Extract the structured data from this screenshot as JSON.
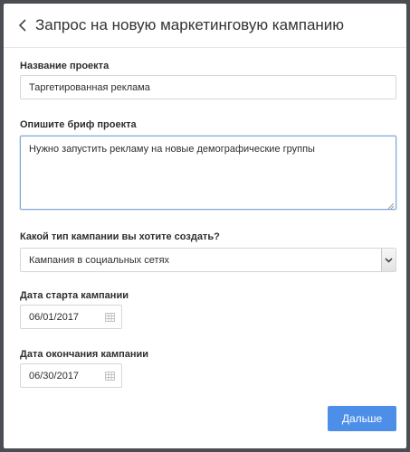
{
  "header": {
    "title": "Запрос на новую маркетинговую кампанию",
    "back_icon": "chevron-left-icon"
  },
  "form": {
    "project_name": {
      "label": "Название проекта",
      "value": "Таргетированная реклама"
    },
    "brief": {
      "label": "Опишите бриф проекта",
      "value": "Нужно запустить рекламу на новые демографические группы"
    },
    "campaign_type": {
      "label": "Какой тип кампании вы хотите создать?",
      "selected": "Кампания в социальных сетях"
    },
    "start_date": {
      "label": "Дата старта кампании",
      "value": "06/01/2017"
    },
    "end_date": {
      "label": "Дата окончания кампании",
      "value": "06/30/2017"
    }
  },
  "actions": {
    "next_label": "Дальше"
  },
  "colors": {
    "primary_button": "#4d8fe8",
    "focus_border": "#7ea7d8",
    "background": "#4a4d52"
  }
}
